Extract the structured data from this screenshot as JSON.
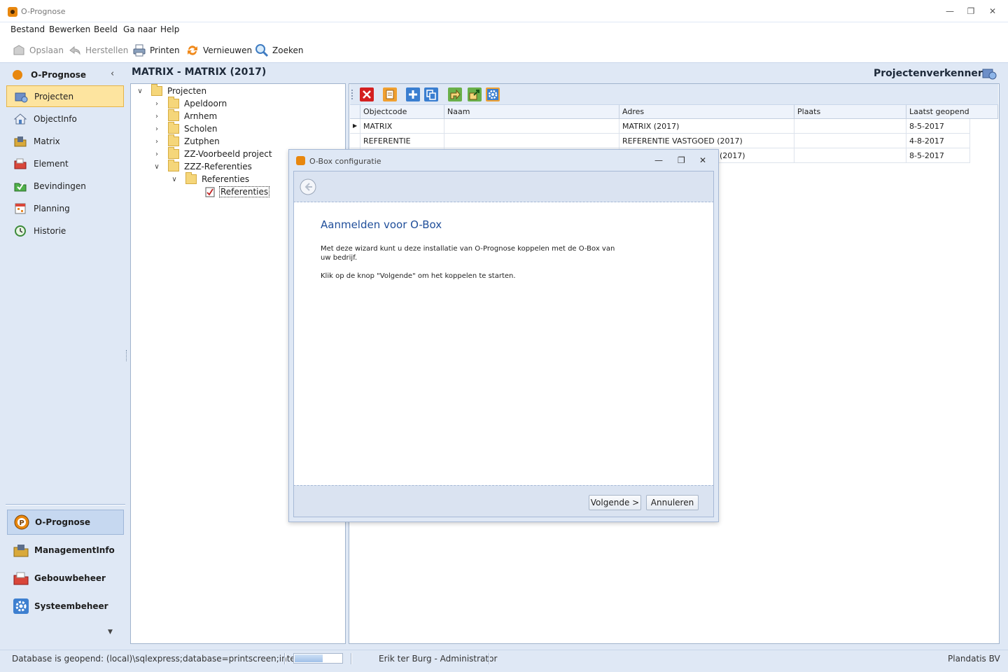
{
  "window": {
    "title": "O-Prognose"
  },
  "menu": [
    "Bestand",
    "Bewerken",
    "Beeld",
    "Ga naar",
    "Help"
  ],
  "toolbar": {
    "save": "Opslaan",
    "restore": "Herstellen",
    "print": "Printen",
    "refresh": "Vernieuwen",
    "search": "Zoeken"
  },
  "nav": {
    "header": "O-Prognose",
    "items": [
      "Projecten",
      "ObjectInfo",
      "Matrix",
      "Element",
      "Bevindingen",
      "Planning",
      "Historie"
    ],
    "groups": [
      "O-Prognose",
      "ManagementInfo",
      "Gebouwbeheer",
      "Systeembeheer"
    ]
  },
  "header": {
    "title": "MATRIX - MATRIX (2017)",
    "section": "Projectenverkenner"
  },
  "tree": {
    "root": "Projecten",
    "children": [
      "Apeldoorn",
      "Arnhem",
      "Scholen",
      "Zutphen",
      "ZZ-Voorbeeld project",
      "ZZZ-Referenties"
    ],
    "sub": "Referenties",
    "leaf": "Referenties"
  },
  "grid": {
    "columns": [
      "Objectcode",
      "Naam",
      "Adres",
      "Plaats",
      "Laatst geopend"
    ],
    "rows": [
      [
        "MATRIX",
        "",
        "MATRIX (2017)",
        "",
        "8-5-2017"
      ],
      [
        "REFERENTIE",
        "",
        "REFERENTIE VASTGOED (2017)",
        "",
        "4-8-2017"
      ],
      [
        "",
        "",
        "(2017)",
        "",
        "8-5-2017"
      ]
    ]
  },
  "dialog": {
    "title": "O-Box configuratie",
    "heading": "Aanmelden voor O-Box",
    "para1_line1": "Met deze wizard kunt u deze installatie van O-Prognose koppelen met de O-Box van",
    "para1_line2": "uw bedrijf.",
    "para2": "Klik op de knop \"Volgende\" om het koppelen te starten.",
    "next": "Volgende >",
    "cancel": "Annuleren"
  },
  "status": {
    "db": "Database is geopend: (local)\\sqlexpress;database=printscreen;integrated",
    "user": "Erik ter Burg - Administrator",
    "company": "Plandatis BV",
    "progress": 0.6
  }
}
